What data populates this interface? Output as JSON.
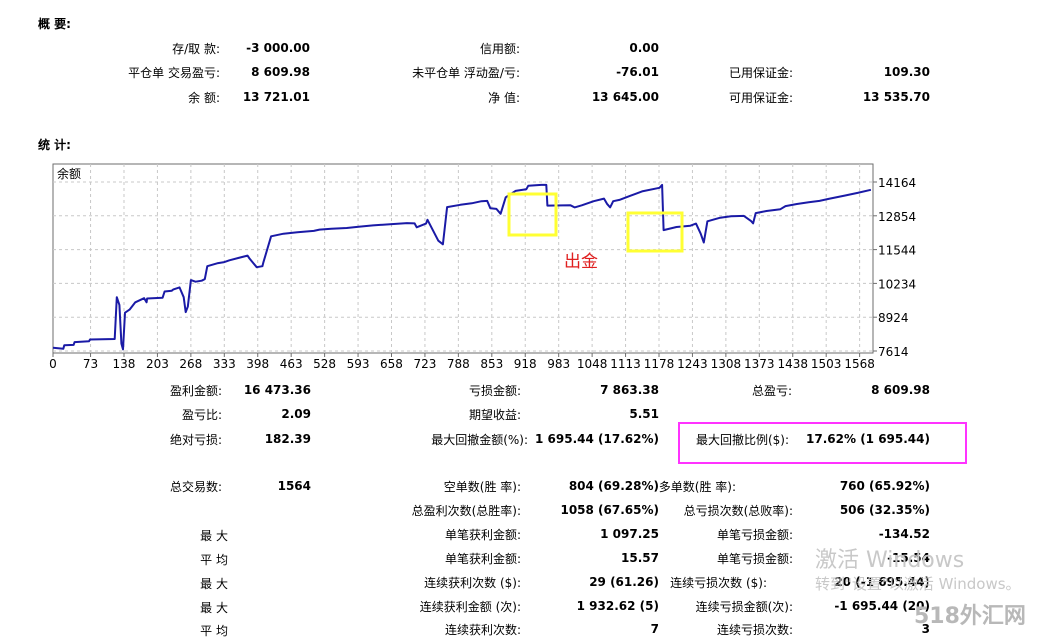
{
  "overview": {
    "title": "概 要:",
    "rows": [
      [
        {
          "label": "存/取 款:",
          "value": "-3 000.00"
        },
        {
          "label": "信用额:",
          "value": "0.00"
        },
        {
          "label": "",
          "value": ""
        }
      ],
      [
        {
          "label": "平仓单 交易盈亏:",
          "value": "8 609.98"
        },
        {
          "label": "未平仓单 浮动盈/亏:",
          "value": "-76.01"
        },
        {
          "label": "已用保证金:",
          "value": "109.30"
        }
      ],
      [
        {
          "label": "余 额:",
          "value": "13 721.01"
        },
        {
          "label": "净 值:",
          "value": "13 645.00"
        },
        {
          "label": "可用保证金:",
          "value": "13 535.70"
        }
      ]
    ]
  },
  "stats_title": "统 计:",
  "chart_data": {
    "type": "line",
    "title": "余额",
    "series": [
      {
        "name": "余额",
        "color": "#1a1aa6",
        "points": [
          [
            0,
            7740
          ],
          [
            20,
            7700
          ],
          [
            22,
            7840
          ],
          [
            40,
            7850
          ],
          [
            42,
            7960
          ],
          [
            70,
            7990
          ],
          [
            72,
            8060
          ],
          [
            120,
            8080
          ],
          [
            124,
            9700
          ],
          [
            129,
            9400
          ],
          [
            133,
            7900
          ],
          [
            136,
            7680
          ],
          [
            140,
            9100
          ],
          [
            149,
            9220
          ],
          [
            160,
            9500
          ],
          [
            177,
            9660
          ],
          [
            182,
            9500
          ],
          [
            183,
            9650
          ],
          [
            213,
            9680
          ],
          [
            217,
            9920
          ],
          [
            231,
            9950
          ],
          [
            234,
            10000
          ],
          [
            246,
            10080
          ],
          [
            254,
            9700
          ],
          [
            258,
            9120
          ],
          [
            262,
            9330
          ],
          [
            268,
            10360
          ],
          [
            277,
            10300
          ],
          [
            289,
            10340
          ],
          [
            295,
            10400
          ],
          [
            300,
            10900
          ],
          [
            321,
            11020
          ],
          [
            333,
            11060
          ],
          [
            343,
            11130
          ],
          [
            360,
            11220
          ],
          [
            378,
            11310
          ],
          [
            382,
            11200
          ],
          [
            396,
            10860
          ],
          [
            407,
            10900
          ],
          [
            409,
            11050
          ],
          [
            424,
            12060
          ],
          [
            448,
            12160
          ],
          [
            475,
            12220
          ],
          [
            507,
            12270
          ],
          [
            518,
            12320
          ],
          [
            541,
            12350
          ],
          [
            571,
            12380
          ],
          [
            594,
            12430
          ],
          [
            622,
            12480
          ],
          [
            655,
            12530
          ],
          [
            688,
            12570
          ],
          [
            703,
            12560
          ],
          [
            707,
            12410
          ],
          [
            725,
            12550
          ],
          [
            728,
            12700
          ],
          [
            749,
            11890
          ],
          [
            758,
            11750
          ],
          [
            766,
            13190
          ],
          [
            792,
            13280
          ],
          [
            814,
            13340
          ],
          [
            833,
            13420
          ],
          [
            844,
            13430
          ],
          [
            850,
            13150
          ],
          [
            862,
            13120
          ],
          [
            870,
            12930
          ],
          [
            880,
            13570
          ],
          [
            899,
            13820
          ],
          [
            920,
            13880
          ],
          [
            924,
            14020
          ],
          [
            949,
            14050
          ],
          [
            959,
            14050
          ],
          [
            961,
            13250
          ],
          [
            1006,
            13260
          ],
          [
            1014,
            13180
          ],
          [
            1028,
            13260
          ],
          [
            1051,
            13420
          ],
          [
            1071,
            13520
          ],
          [
            1077,
            13320
          ],
          [
            1083,
            13180
          ],
          [
            1089,
            13420
          ],
          [
            1101,
            13470
          ],
          [
            1122,
            13630
          ],
          [
            1145,
            13800
          ],
          [
            1179,
            13940
          ],
          [
            1184,
            14050
          ],
          [
            1187,
            12300
          ],
          [
            1212,
            12420
          ],
          [
            1239,
            12470
          ],
          [
            1250,
            12550
          ],
          [
            1259,
            12160
          ],
          [
            1265,
            11820
          ],
          [
            1272,
            12640
          ],
          [
            1297,
            12780
          ],
          [
            1318,
            12840
          ],
          [
            1343,
            12850
          ],
          [
            1357,
            12650
          ],
          [
            1361,
            12560
          ],
          [
            1366,
            12960
          ],
          [
            1387,
            13040
          ],
          [
            1414,
            13110
          ],
          [
            1424,
            13230
          ],
          [
            1446,
            13310
          ],
          [
            1469,
            13380
          ],
          [
            1490,
            13430
          ],
          [
            1510,
            13520
          ],
          [
            1540,
            13640
          ],
          [
            1564,
            13740
          ],
          [
            1590,
            13860
          ]
        ]
      }
    ],
    "x_ticks": [
      "0",
      "73",
      "138",
      "203",
      "268",
      "333",
      "398",
      "463",
      "528",
      "593",
      "658",
      "723",
      "788",
      "853",
      "918",
      "983",
      "1048",
      "1113",
      "1178",
      "1243",
      "1308",
      "1373",
      "1438",
      "1503",
      "1568"
    ],
    "y_ticks": [
      "14164",
      "12854",
      "11544",
      "10234",
      "8924",
      "7614"
    ],
    "xlim": [
      0,
      1594
    ],
    "ylim": [
      7614,
      14164
    ],
    "grid": true,
    "annotations": [
      {
        "text": "出金",
        "color": "#e02020"
      }
    ]
  },
  "stats": {
    "r1": [
      {
        "label": "盈利金额:",
        "value": "16 473.36"
      },
      {
        "label": "亏损金额:",
        "value": "7 863.38"
      },
      {
        "label": "总盈亏:",
        "value": "8 609.98"
      }
    ],
    "r2": [
      {
        "label": "盈亏比:",
        "value": "2.09"
      },
      {
        "label": "期望收益:",
        "value": "5.51"
      }
    ],
    "r3": [
      {
        "label": "绝对亏损:",
        "value": "182.39"
      },
      {
        "label": "最大回撤金额(%):",
        "value": "1 695.44 (17.62%)"
      },
      {
        "label": "最大回撤比例($):",
        "value": "17.62% (1 695.44)"
      }
    ],
    "r4": [
      {
        "label": "总交易数:",
        "value": "1564"
      },
      {
        "label": "空单数(胜 率):",
        "value": "804 (69.28%)"
      },
      {
        "label": "多单数(胜 率):",
        "value": "760 (65.92%)"
      }
    ],
    "r5": [
      {
        "label": "总盈利次数(总胜率):",
        "value": "1058 (67.65%)"
      },
      {
        "label": "总亏损次数(总败率):",
        "value": "506 (32.35%)"
      }
    ],
    "r6": [
      {
        "label": "最 大",
        "value": ""
      },
      {
        "label": "单笔获利金额:",
        "value": "1 097.25"
      },
      {
        "label": "单笔亏损金额:",
        "value": "-134.52"
      }
    ],
    "r7": [
      {
        "label": "平 均",
        "value": ""
      },
      {
        "label": "单笔获利金额:",
        "value": "15.57"
      },
      {
        "label": "单笔亏损金额:",
        "value": "-15.54"
      }
    ],
    "r8": [
      {
        "label": "最 大",
        "value": ""
      },
      {
        "label": "连续获利次数 ($):",
        "value": "29 (61.26)"
      },
      {
        "label": "连续亏损次数 ($):",
        "value": "20 (-1 695.44)"
      }
    ],
    "r9": [
      {
        "label": "最 大",
        "value": ""
      },
      {
        "label": "连续获利金额 (次):",
        "value": "1 932.62 (5)"
      },
      {
        "label": "连续亏损金额(次):",
        "value": "-1 695.44 (20)"
      }
    ],
    "r10": [
      {
        "label": "平 均",
        "value": ""
      },
      {
        "label": "连续获利次数:",
        "value": "7"
      },
      {
        "label": "连续亏损次数:",
        "value": "3"
      }
    ]
  },
  "highlight_colors": {
    "yellow": "#ffff33",
    "magenta": "#ff33ff"
  },
  "watermark": {
    "line1": "激活 Windows",
    "line2": "转到\"设置\"以激活 Windows。",
    "site": "518外汇网"
  }
}
